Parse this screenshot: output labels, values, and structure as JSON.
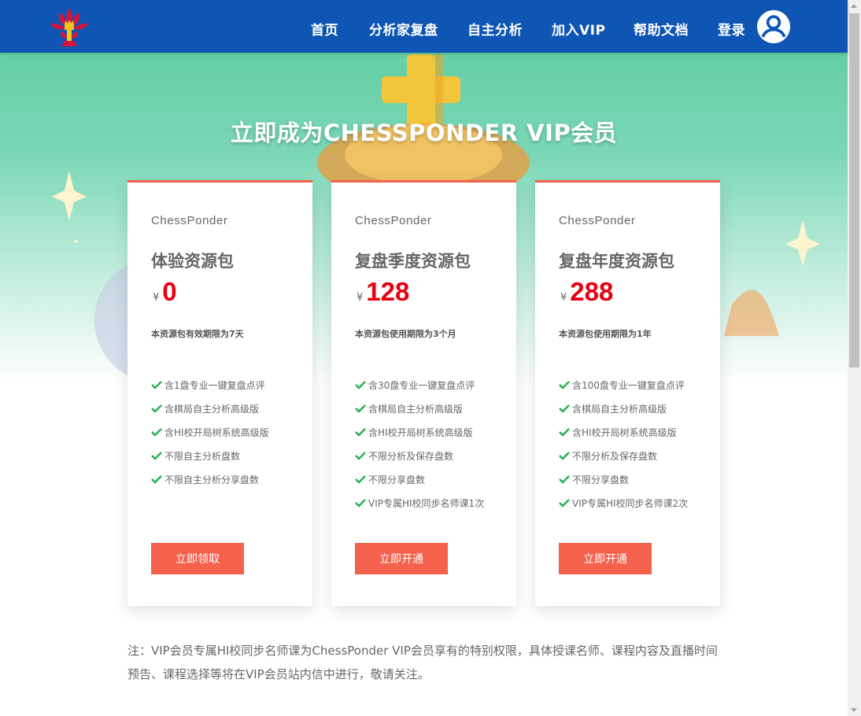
{
  "header": {
    "nav": [
      {
        "label": "首页"
      },
      {
        "label": "分析家复盘"
      },
      {
        "label": "自主分析"
      },
      {
        "label": "加入VIP"
      },
      {
        "label": "帮助文档"
      },
      {
        "label": "登录"
      }
    ],
    "logo_icon": "chess-crown-flower-logo",
    "avatar_icon": "user-avatar-icon"
  },
  "hero": {
    "title": "立即成为CHESSPONDER VIP会员"
  },
  "plans": [
    {
      "brand": "ChessPonder",
      "name": "体验资源包",
      "currency": "¥",
      "price": "0",
      "desc": "本资源包有效期限为7天",
      "features": [
        "含1盘专业一键复盘点评",
        "含棋局自主分析高级版",
        "含HI校开局树系统高级版",
        "不限自主分析盘数",
        "不限自主分析分享盘数"
      ],
      "cta": "立即领取"
    },
    {
      "brand": "ChessPonder",
      "name": "复盘季度资源包",
      "currency": "¥",
      "price": "128",
      "desc": "本资源包使用期限为3个月",
      "features": [
        "含30盘专业一键复盘点评",
        "含棋局自主分析高级版",
        "含HI校开局树系统高级版",
        "不限分析及保存盘数",
        "不限分享盘数",
        "VIP专属HI校同步名师课1次"
      ],
      "cta": "立即开通"
    },
    {
      "brand": "ChessPonder",
      "name": "复盘年度资源包",
      "currency": "¥",
      "price": "288",
      "desc": "本资源包使用期限为1年",
      "features": [
        "含100盘专业一键复盘点评",
        "含棋局自主分析高级版",
        "含HI校开局树系统高级版",
        "不限分析及保存盘数",
        "不限分享盘数",
        "VIP专属HI校同步名师课2次"
      ],
      "cta": "立即开通"
    }
  ],
  "note": "注：VIP会员专属HI校同步名师课为ChessPonder VIP会员享有的特别权限，具体授课名师、课程内容及直播时间预告、课程选择等将在VIP会员站内信中进行，敬请关注。",
  "colors": {
    "header_bg": "#0e55b4",
    "accent": "#f4614c",
    "price": "#e60012",
    "check": "#22b14c",
    "hero_green": "#64cfa6"
  }
}
